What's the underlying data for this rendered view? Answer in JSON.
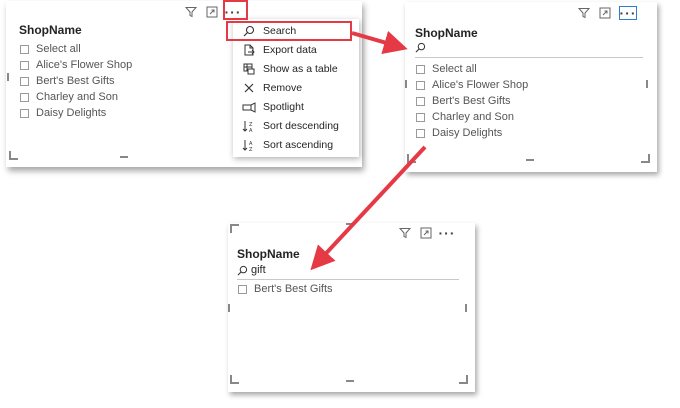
{
  "slicer": {
    "title": "ShopName",
    "items": [
      "Select all",
      "Alice's Flower Shop",
      "Bert's Best Gifts",
      "Charley and Son",
      "Daisy Delights"
    ]
  },
  "context_menu": {
    "items": [
      {
        "label": "Search",
        "icon": "search-icon"
      },
      {
        "label": "Export data",
        "icon": "export-icon"
      },
      {
        "label": "Show as a table",
        "icon": "table-icon"
      },
      {
        "label": "Remove",
        "icon": "close-icon"
      },
      {
        "label": "Spotlight",
        "icon": "spotlight-icon"
      },
      {
        "label": "Sort descending",
        "icon": "sort-descending-icon"
      },
      {
        "label": "Sort ascending",
        "icon": "sort-ascending-icon"
      }
    ]
  },
  "search_panel": {
    "title": "ShopName",
    "search_value": "",
    "items": [
      "Select all",
      "Alice's Flower Shop",
      "Bert's Best Gifts",
      "Charley and Son",
      "Daisy Delights"
    ]
  },
  "filtered_panel": {
    "title": "ShopName",
    "search_value": "gift",
    "items": [
      "Bert's Best Gifts"
    ]
  },
  "toolbar": {
    "more_label": "···"
  },
  "colors": {
    "highlight": "#e63946",
    "focus_blue": "#2b7cd3",
    "text": "#252423"
  }
}
